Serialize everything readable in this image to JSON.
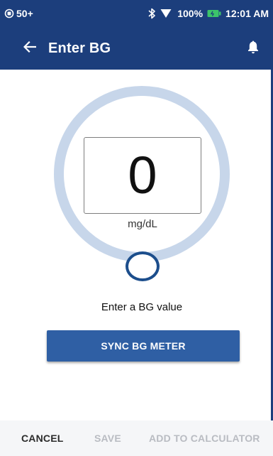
{
  "status_bar": {
    "left_text": "50+",
    "battery_percent": "100%",
    "time": "12:01 AM"
  },
  "app_bar": {
    "title": "Enter BG"
  },
  "bg_entry": {
    "value": "0",
    "unit": "mg/dL",
    "prompt": "Enter a BG value"
  },
  "buttons": {
    "sync": "SYNC BG METER"
  },
  "actions": {
    "cancel": "CANCEL",
    "save": "SAVE",
    "add_to_calculator": "ADD TO CALCULATOR"
  },
  "icons": {
    "status_left": "pod-status-icon",
    "bluetooth": "bluetooth-icon",
    "signal": "signal-icon",
    "battery": "battery-icon",
    "back": "arrow-left-icon",
    "notifications": "bell-icon"
  },
  "colors": {
    "header": "#1c3e7c",
    "dial_ring": "#c7d6ea",
    "handle": "#1c4e8c",
    "primary_button": "#2f5fa4",
    "battery": "#3cc46a",
    "disabled_text": "#b9bcc2"
  }
}
